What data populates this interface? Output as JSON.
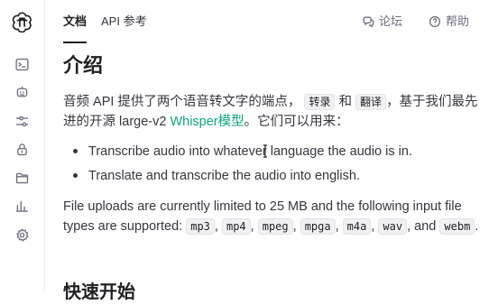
{
  "top_nav": {
    "tab_docs": "文档",
    "tab_api_ref": "API 参考",
    "forum": "论坛",
    "help": "帮助"
  },
  "sidebar": {
    "icons": [
      "openai-logo-icon",
      "terminal-icon",
      "robot-icon",
      "sliders-icon",
      "lock-icon",
      "folder-icon",
      "bar-chart-icon",
      "gear-icon"
    ]
  },
  "main": {
    "title": "介绍",
    "intro_part1": "音频 API 提供了两个语音转文字的端点，",
    "code_transcribe": "转录",
    "intro_and": "和",
    "code_translate": "翻译",
    "intro_part2": "，基于我们最先进的开源 large-v2 ",
    "whisper_link": "Whisper模型",
    "intro_part3": "。它们可以用来：",
    "bullets": [
      "Transcribe audio into whatever language the audio is in.",
      "Translate and transcribe the audio into english."
    ],
    "upload_text_part1": "File uploads are currently limited to 25 MB and the following input file types are supported: ",
    "formats": [
      "mp3",
      "mp4",
      "mpeg",
      "mpga",
      "m4a",
      "wav",
      "webm"
    ],
    "upload_text_and": "and",
    "upload_text_end": ".",
    "section_heading": "快速开始"
  }
}
